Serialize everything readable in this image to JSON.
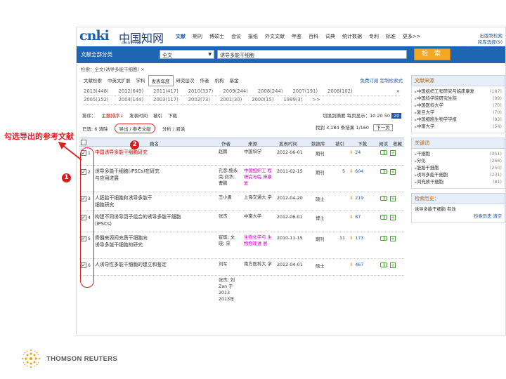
{
  "header": {
    "logo_main": "cnki",
    "logo_cjk": "中国知网",
    "logo_sub": "cnki.net",
    "nav": [
      "文献",
      "期刊",
      "博硕士",
      "会议",
      "报纸",
      "外文文献",
      "年鉴",
      "百科",
      "词典",
      "统计数据",
      "专利",
      "标准",
      "更多>>"
    ],
    "active_nav": "文献",
    "links": [
      "出版物检索",
      "跨库选择(9)",
      "结果中检索  高级检索"
    ]
  },
  "search": {
    "category": "文献全部分类",
    "field": "全文",
    "query": "诱导多能干细胞",
    "button": "检 索"
  },
  "breadcrumb": "检索：全文(诱导多能干细胞)   ×",
  "filters": {
    "tabs": [
      "文献检索",
      "中英文扩展",
      "学科",
      "发表年度",
      "研究层次",
      "作者",
      "机构",
      "基金"
    ],
    "selected_tab": "发表年度",
    "tabs_right": "免费订阅  定制检索式",
    "year_rows": [
      [
        "2013(448)",
        "2012(649)",
        "2011(417)",
        "2010(337)",
        "2009(244)",
        "2008(244)",
        "2007(191)",
        "2006(102)"
      ],
      [
        "2005(152)",
        "2004(144)",
        "2003(117)",
        "2002(73)",
        "2001(30)",
        "2000(15)",
        "1999(3)",
        ">>"
      ]
    ],
    "close": "×"
  },
  "toolbar": {
    "sort_items": [
      "排序：",
      "主题排序↓",
      "发表时间",
      "被引",
      "下载"
    ],
    "sort_red": "主题排序↓",
    "row2": [
      "已选: 6 清除",
      "导出 / 参考文献",
      "分析 / 阅读"
    ],
    "export_label": "导出 / 参考文献",
    "stats": "切换到摘要  每页显示：10  20  50",
    "page_current": "20",
    "stats2": "找到 3,184 条结果  1/160",
    "next_page": "下一页"
  },
  "table": {
    "headers": [
      "篇名",
      "作者",
      "来源",
      "发表时间",
      "数据库",
      "被引",
      "下载",
      "阅读",
      "收藏"
    ],
    "rows": [
      {
        "n": "1",
        "checked": "✓",
        "title_a": "中国诱导多能干细胞研究",
        "title_b": "",
        "title_hot": "诱导多能干细胞",
        "author": "赵鹏",
        "source": "中国科学",
        "date": "2012-06-01",
        "db": "期刊",
        "cited": "",
        "downloads": "24"
      },
      {
        "n": "2",
        "checked": "✓",
        "title_a": "诱导多能干细胞(iPSCs)在研究",
        "title_b": "与应用进展",
        "title_hot": "",
        "author": "孔彦;鲍永 荣;刘华; 曹鹏",
        "source": "中国组织工 程研究与临 床康复",
        "date": "2011-02-15",
        "db": "期刊",
        "cited": "5",
        "downloads": "604"
      },
      {
        "n": "3",
        "checked": "✓",
        "title_a": "人胚胎干细胞和诱导多能干",
        "title_b": "细胞研究",
        "title_hot": "",
        "author": "王小勇",
        "source": "上海交通大 学",
        "date": "2012-04-20",
        "db": "硕士",
        "cited": "",
        "downloads": "219"
      },
      {
        "n": "4",
        "checked": "✓",
        "title_a": "构建不同诱导因子组合的诱导多能干细胞",
        "title_b": "(iPSCs)",
        "title_hot": "",
        "author": "张杰",
        "source": "中南大学",
        "date": "2012-06-01",
        "db": "博士",
        "cited": "",
        "downloads": "87"
      },
      {
        "n": "5",
        "checked": "✓",
        "title_a": "骨髓来源间充质干细胞向",
        "title_b": "诱导多能干细胞的研究",
        "title_hot": "",
        "author": "崔辉; 文 晓; 宋",
        "source": "生物化学与 生物物理进 展",
        "date": "2010-11-15",
        "db": "期刊",
        "cited": "11",
        "downloads": "173"
      },
      {
        "n": "6",
        "checked": "✓",
        "title_a": "人诱导性多能干细胞的建立和鉴定",
        "title_b": "",
        "title_hot": "",
        "author": "刘军",
        "source": "南方医科大 学",
        "date": "2012-04-01",
        "db": "硕士",
        "cited": "",
        "downloads": "467"
      }
    ],
    "overflow_text": "张杰; 刘 Zan 于 2013 2013年"
  },
  "sidebar": {
    "source_title": "文献来源",
    "sources": [
      {
        "label": "中国组织工程研究与临床康复",
        "count": "(187)"
      },
      {
        "label": "中国科学院研究生院",
        "count": "(99)"
      },
      {
        "label": "中国医科大学",
        "count": "(70)"
      },
      {
        "label": "复旦大学",
        "count": "(70)"
      },
      {
        "label": "中国细胞生物学学报",
        "count": "(83)"
      },
      {
        "label": "中南大学",
        "count": "(54)"
      }
    ],
    "keyword_title": "关键词",
    "keywords": [
      {
        "label": "干细胞",
        "count": "(351)"
      },
      {
        "label": "分化",
        "count": "(266)"
      },
      {
        "label": "胚胎干细胞",
        "count": "(250)"
      },
      {
        "label": "诱导多能干细胞",
        "count": "(231)"
      },
      {
        "label": "间充质干细胞",
        "count": "(81)"
      }
    ],
    "history_title": "检索历史：",
    "history_item": "诱导多能干细胞  有效",
    "history_links": "检索历史  清空"
  },
  "annotations": {
    "label": "勾选导出的参考文献",
    "badge1": "1",
    "badge2": "2",
    "color": "#e01f1f"
  },
  "footer": {
    "brand": "THOMSON REUTERS"
  }
}
